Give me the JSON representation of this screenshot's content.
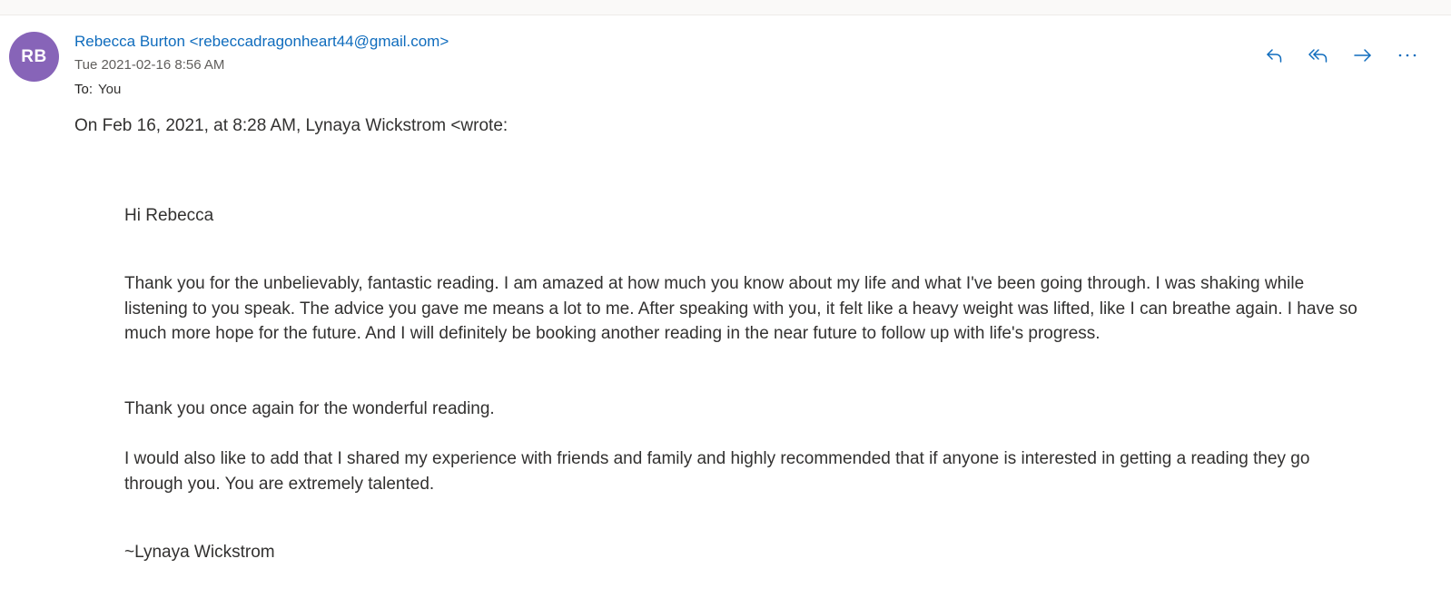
{
  "email": {
    "avatar_initials": "RB",
    "avatar_color": "#8764b8",
    "sender": "Rebecca Burton <rebeccadragonheart44@gmail.com>",
    "date": "Tue 2021-02-16 8:56 AM",
    "to_label": "To:",
    "to_value": "You",
    "quote_header": "On Feb 16, 2021, at 8:28 AM, Lynaya Wickstrom <wrote:",
    "body": {
      "greeting": "Hi Rebecca",
      "paragraph_1": "Thank you for the unbelievably, fantastic reading.  I am amazed at how much you know about my life and what I've been going through.  I was shaking while listening to you speak.  The advice you gave me means a lot to me. After speaking with you, it felt like a heavy weight was lifted, like I can breathe again.  I have so much more hope for the future. And I will definitely be booking another reading in the near future to follow up with life's progress.",
      "paragraph_2": "Thank you once again for the wonderful reading.",
      "paragraph_3": "I would also like to add that I shared my experience with friends and family and highly recommended that if anyone is interested in getting a reading they go through you. You are extremely talented.",
      "signature": "~Lynaya Wickstrom"
    }
  },
  "actions": [
    {
      "name": "reply",
      "icon": "reply-icon"
    },
    {
      "name": "reply-all",
      "icon": "reply-all-icon"
    },
    {
      "name": "forward",
      "icon": "forward-icon"
    },
    {
      "name": "more",
      "icon": "more-icon"
    }
  ],
  "colors": {
    "accent": "#0f6cbd",
    "text": "#323130",
    "muted": "#605e5c"
  }
}
